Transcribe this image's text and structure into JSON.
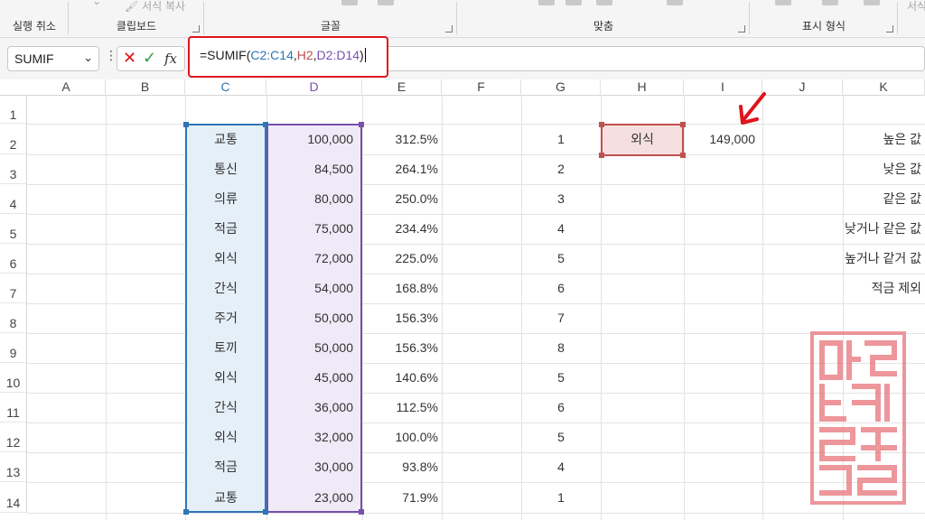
{
  "ribbon": {
    "groups": [
      {
        "label": "실행 취소"
      },
      {
        "label": "클립보드"
      },
      {
        "label": "글꼴"
      },
      {
        "label": "맞춤"
      },
      {
        "label": "표시 형식"
      }
    ],
    "format_painter_label": "서식 복사",
    "right_clip_label": "서식"
  },
  "formula_bar": {
    "name_box": "SUMIF",
    "cancel_glyph": "✕",
    "enter_glyph": "✓",
    "fx_glyph": "fx",
    "formula_parts": [
      "=SUMIF(",
      "C2:C14",
      ",",
      "H2",
      ",",
      "D2:D14",
      ")"
    ]
  },
  "columns": [
    "A",
    "B",
    "C",
    "D",
    "E",
    "F",
    "G",
    "H",
    "I",
    "J",
    "K"
  ],
  "rows": [
    "1",
    "2",
    "3",
    "4",
    "5",
    "6",
    "7",
    "8",
    "9",
    "10",
    "11",
    "12",
    "13",
    "14"
  ],
  "table": {
    "C": [
      "교통",
      "통신",
      "의류",
      "적금",
      "외식",
      "간식",
      "주거",
      "토끼",
      "외식",
      "간식",
      "외식",
      "적금",
      "교통"
    ],
    "D": [
      "100,000",
      "84,500",
      "80,000",
      "75,000",
      "72,000",
      "54,000",
      "50,000",
      "50,000",
      "45,000",
      "36,000",
      "32,000",
      "30,000",
      "23,000"
    ],
    "E": [
      "312.5%",
      "264.1%",
      "250.0%",
      "234.4%",
      "225.0%",
      "168.8%",
      "156.3%",
      "156.3%",
      "140.6%",
      "112.5%",
      "100.0%",
      "93.8%",
      "71.9%"
    ],
    "G": [
      "1",
      "2",
      "3",
      "4",
      "5",
      "6",
      "7",
      "8",
      "5",
      "6",
      "5",
      "4",
      "1"
    ]
  },
  "criteria_cell": {
    "H2": "외식"
  },
  "result_cell": {
    "I2": "149,000"
  },
  "k_labels": [
    "높은 값",
    "낮은 값",
    "같은 값",
    "낮거나 같은 값",
    "높거나 같거 값",
    "적금 제외"
  ],
  "colors": {
    "range_c": "#2f75b5",
    "range_d": "#7a4fae",
    "criteria": "#c0504d",
    "highlight_box": "#e0141c",
    "stamp": "#e8737a"
  }
}
